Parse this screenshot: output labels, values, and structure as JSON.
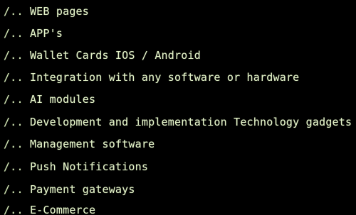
{
  "lines": [
    {
      "prefix": "/..",
      "text": "WEB pages"
    },
    {
      "prefix": "/..",
      "text": "APP's"
    },
    {
      "prefix": "/..",
      "text": "Wallet Cards IOS / Android"
    },
    {
      "prefix": "/..",
      "text": "Integration with any software or hardware"
    },
    {
      "prefix": "/..",
      "text": "AI modules"
    },
    {
      "prefix": "/..",
      "text": "Development and implementation Technology gadgets"
    },
    {
      "prefix": "/..",
      "text": "Management software"
    },
    {
      "prefix": "/..",
      "text": "Push Notifications"
    },
    {
      "prefix": "/..",
      "text": "Payment gateways"
    },
    {
      "prefix": "/..",
      "text": "E-Commerce"
    }
  ],
  "colors": {
    "background": "#000000",
    "text": "#e3f2c8"
  }
}
